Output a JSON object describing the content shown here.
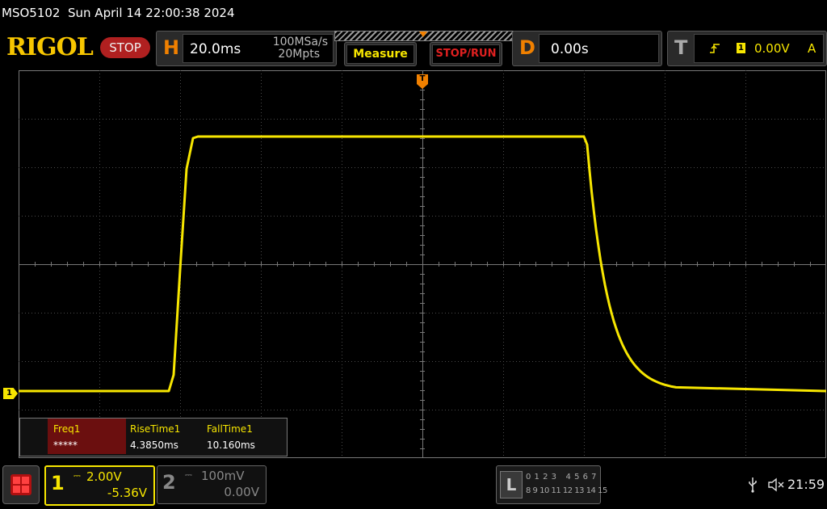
{
  "title_bar": {
    "model": "MSO5102",
    "datetime": "Sun April 14 22:00:38 2024"
  },
  "brand": {
    "logo_text": "RIGOL",
    "run_state": "STOP"
  },
  "horizontal": {
    "letter": "H",
    "timebase": "20.0ms",
    "sample_rate": "100MSa/s",
    "memory_depth": "20Mpts"
  },
  "buttons": {
    "measure": "Measure",
    "stop_run": "STOP/RUN"
  },
  "delay": {
    "letter": "D",
    "value": "0.00s"
  },
  "trigger": {
    "letter": "T",
    "source": "1",
    "level": "0.00V",
    "mode": "A"
  },
  "trigger_marker": "T",
  "channel1_marker": "1",
  "measurements": [
    {
      "name": "Freq1",
      "value": "*****"
    },
    {
      "name": "RiseTime1",
      "value": "4.3850ms"
    },
    {
      "name": "FallTime1",
      "value": "10.160ms"
    }
  ],
  "channel1": {
    "number": "1",
    "scale": "2.00V",
    "offset": "-5.36V",
    "color": "#f7e600"
  },
  "channel2": {
    "number": "2",
    "scale": "100mV",
    "offset": "0.00V"
  },
  "logic_analyzer": {
    "letter": "L",
    "row1": "0 1 2 3   4 5 6 7",
    "row2": "8 9 10 11 12 13 14 15"
  },
  "status": {
    "clock": "21:59"
  },
  "colors": {
    "trace": "#f7e600",
    "accent": "#f08000",
    "stop": "#b02020",
    "alarm": "#e02020"
  }
}
